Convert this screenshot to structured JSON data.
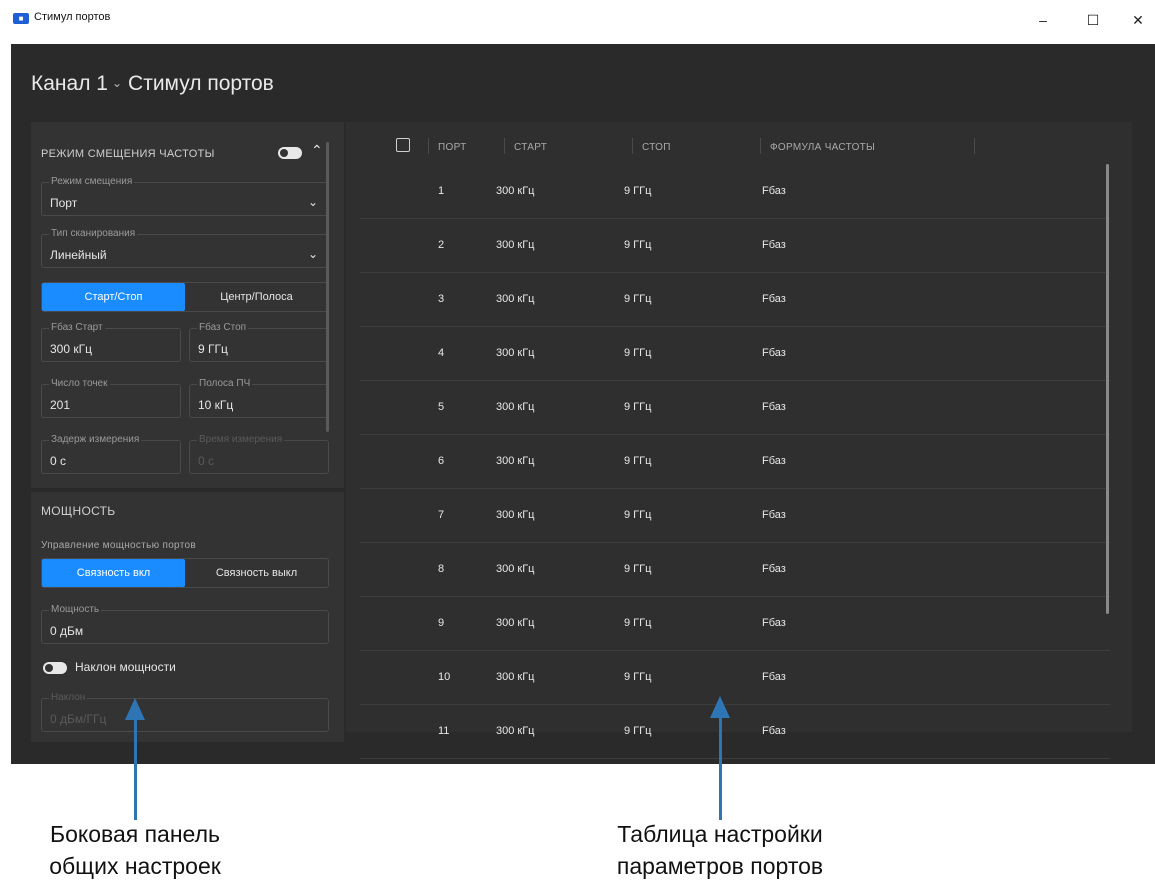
{
  "window": {
    "title": "Стимул портов",
    "app_icon": "app-icon",
    "minimize": "–",
    "maximize": "☐",
    "close": "✕"
  },
  "header": {
    "channel": "Канал 1",
    "chevron": "⌄",
    "title": "Стимул портов"
  },
  "sidebar": {
    "freq_section": {
      "title": "РЕЖИМ СМЕЩЕНИЯ ЧАСТОТЫ",
      "toggle_on": false,
      "collapse": "⌃",
      "offset_mode": {
        "label": "Режим смещения",
        "value": "Порт"
      },
      "sweep_type": {
        "label": "Тип сканирования",
        "value": "Линейный"
      },
      "range_mode": {
        "options": [
          "Старт/Стоп",
          "Центр/Полоса"
        ],
        "selected": "Старт/Стоп"
      },
      "fbase_start": {
        "label": "Fбаз Старт",
        "value": "300 кГц"
      },
      "fbase_stop": {
        "label": "Fбаз Стоп",
        "value": "9 ГГц"
      },
      "points": {
        "label": "Число точек",
        "value": "201"
      },
      "if_bw": {
        "label": "Полоса ПЧ",
        "value": "10 кГц"
      },
      "meas_delay": {
        "label": "Задерж измерения",
        "value": "0 с"
      },
      "meas_time": {
        "label": "Время измерения",
        "value": "0 с",
        "disabled": true
      }
    },
    "power_section": {
      "title": "МОЩНОСТЬ",
      "control_label": "Управление мощностью портов",
      "coupling": {
        "options": [
          "Связность вкл",
          "Связность выкл"
        ],
        "selected": "Связность вкл"
      },
      "power": {
        "label": "Мощность",
        "value": "0 дБм"
      },
      "slope_toggle": {
        "label": "Наклон мощности",
        "on": false
      },
      "slope": {
        "label": "Наклон",
        "value": "0 дБм/ГГц",
        "disabled": true
      }
    }
  },
  "table": {
    "columns": [
      "ПОРТ",
      "СТАРТ",
      "СТОП",
      "ФОРМУЛА ЧАСТОТЫ"
    ],
    "rows": [
      [
        "1",
        "300 кГц",
        "9 ГГц",
        "Fбаз"
      ],
      [
        "2",
        "300 кГц",
        "9 ГГц",
        "Fбаз"
      ],
      [
        "3",
        "300 кГц",
        "9 ГГц",
        "Fбаз"
      ],
      [
        "4",
        "300 кГц",
        "9 ГГц",
        "Fбаз"
      ],
      [
        "5",
        "300 кГц",
        "9 ГГц",
        "Fбаз"
      ],
      [
        "6",
        "300 кГц",
        "9 ГГц",
        "Fбаз"
      ],
      [
        "7",
        "300 кГц",
        "9 ГГц",
        "Fбаз"
      ],
      [
        "8",
        "300 кГц",
        "9 ГГц",
        "Fбаз"
      ],
      [
        "9",
        "300 кГц",
        "9 ГГц",
        "Fбаз"
      ],
      [
        "10",
        "300 кГц",
        "9 ГГц",
        "Fбаз"
      ],
      [
        "11",
        "300 кГц",
        "9 ГГц",
        "Fбаз"
      ]
    ]
  },
  "annotations": {
    "sidebar": [
      "Боковая панель",
      "общих настроек"
    ],
    "table": [
      "Таблица настройки",
      "параметров портов"
    ]
  },
  "colors": {
    "accent": "#1a8cff",
    "background": "#2a2a2a",
    "panel": "#333333",
    "annotation_arrow": "#2e75b6"
  }
}
